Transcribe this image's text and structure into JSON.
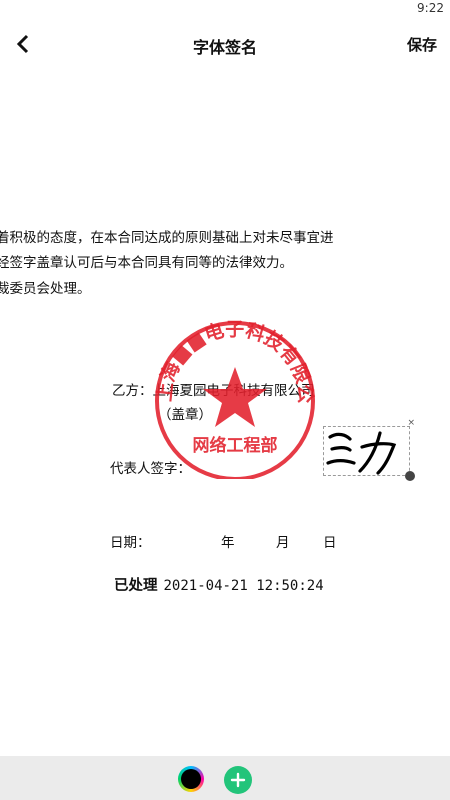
{
  "status_bar": {
    "time": "9:22"
  },
  "header": {
    "title": "字体签名",
    "save_label": "保存",
    "back_icon": "chevron-left-icon"
  },
  "document": {
    "lines": [
      "着积极的态度，在本合同达成的原则基础上对未尽事宜进",
      "经签字盖章认可后与本合同具有同等的法律效力。",
      "裁委员会处理。"
    ],
    "party_b": "乙方：上海夏园电子科技有限公司",
    "seal_note": "（盖章）",
    "rep_sign_label": "代表人签字：",
    "date_label": "日期：",
    "year": "年",
    "month": "月",
    "day": "日",
    "processed_label": "已处理",
    "processed_time": "2021-04-21 12:50:24"
  },
  "stamp": {
    "top_text": "上海■■电子科技有限公司",
    "bottom_text": "网络工程部",
    "color": "#e2202c"
  },
  "signature": {
    "close_symbol": "×",
    "ink_color": "#000000"
  },
  "toolbar": {
    "color_icon": "color-picker-icon",
    "add_icon": "add-icon",
    "accent": "#22c47a"
  }
}
